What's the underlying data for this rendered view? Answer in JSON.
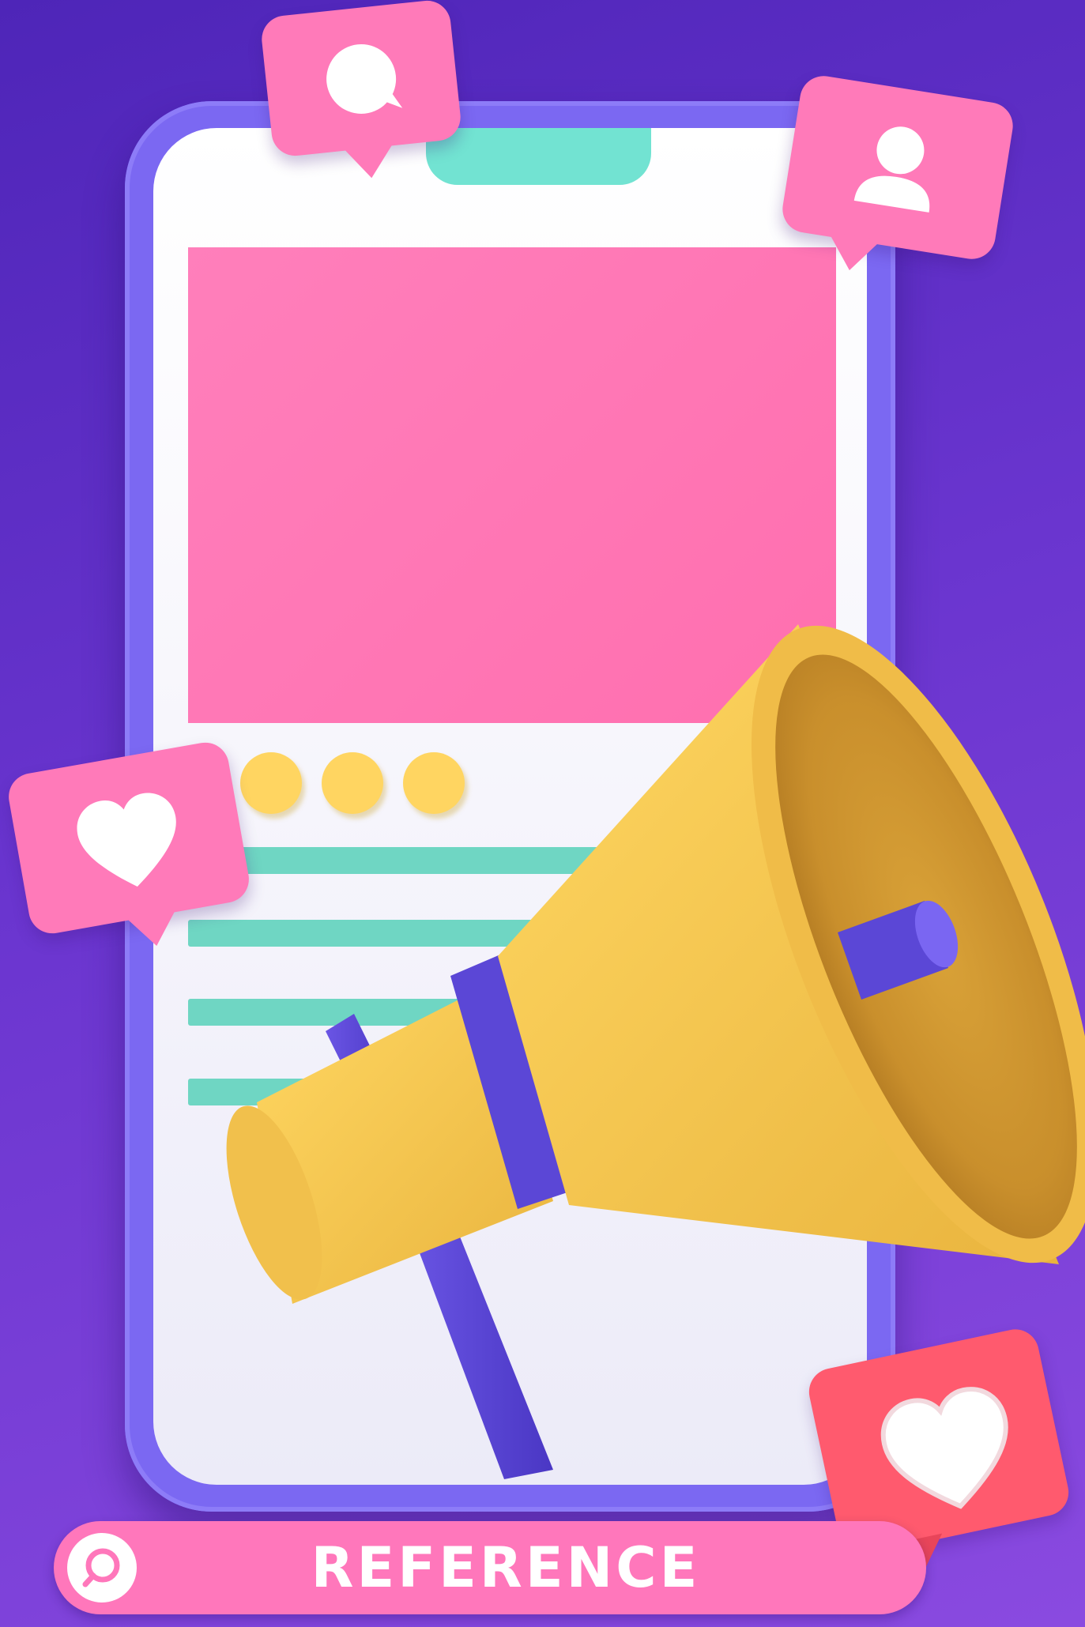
{
  "colors": {
    "background": "#5a2cc4",
    "phone_frame": "#7b68f2",
    "banner": "#ff74b5",
    "accent_teal": "#6fd6c3",
    "accent_yellow": "#ffd561",
    "bubble_pink": "#ff7ab9",
    "bubble_red": "#ff5a6e",
    "megaphone_band": "#5b47d6"
  },
  "icons": [
    "chat-icon",
    "user-icon",
    "heart-icon",
    "heart-icon",
    "megaphone-icon",
    "search-icon"
  ],
  "footer": {
    "label": "REFERENCE"
  }
}
